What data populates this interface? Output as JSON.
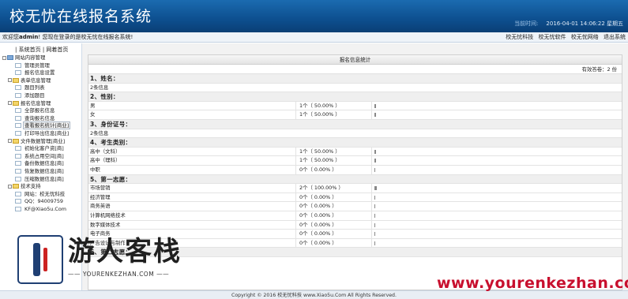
{
  "header": {
    "title": "校无忧在线报名系统",
    "time_label": "当前时间:",
    "time_value": "2016-04-01 14:06:22 星期五"
  },
  "welcome": {
    "prefix": "欢迎您",
    "user": "admin",
    "suffix": "! 您现在登录的是校无忧在线报名系统!",
    "links": [
      "校无忧科技",
      "校无忧软件",
      "校无忧网络",
      "退出系统"
    ]
  },
  "sidebar": {
    "top_links": [
      "系统首页",
      "网着首页"
    ],
    "tree": [
      {
        "label": "网站内容管理",
        "level": 0,
        "type": "root"
      },
      {
        "label": "管理员管理",
        "level": 2,
        "type": "page"
      },
      {
        "label": "报名信息设置",
        "level": 2,
        "type": "page"
      },
      {
        "label": "表单信息管理",
        "level": 1,
        "type": "folder"
      },
      {
        "label": "题目列表",
        "level": 2,
        "type": "page"
      },
      {
        "label": "添加题目",
        "level": 2,
        "type": "page"
      },
      {
        "label": "报名信息管理",
        "level": 1,
        "type": "folder"
      },
      {
        "label": "全部报名信息",
        "level": 2,
        "type": "page"
      },
      {
        "label": "查询报名信息",
        "level": 2,
        "type": "page"
      },
      {
        "label": "查看报名统计[商业]",
        "level": 2,
        "type": "page",
        "active": true
      },
      {
        "label": "打印导出信息[商业]",
        "level": 2,
        "type": "page"
      },
      {
        "label": "文件数据管理[商业]",
        "level": 1,
        "type": "folder"
      },
      {
        "label": "初始化客户资[商]",
        "level": 2,
        "type": "page"
      },
      {
        "label": "系统占用空间[商]",
        "level": 2,
        "type": "page"
      },
      {
        "label": "备份数据信息[商]",
        "level": 2,
        "type": "page"
      },
      {
        "label": "恢复数据信息[商]",
        "level": 2,
        "type": "page"
      },
      {
        "label": "压缩数据信息[商]",
        "level": 2,
        "type": "page"
      },
      {
        "label": "技术支持",
        "level": 1,
        "type": "folder"
      },
      {
        "label": "网站：校无忧科技",
        "level": 2,
        "type": "page"
      },
      {
        "label": "QQ：94009759",
        "level": 2,
        "type": "page"
      },
      {
        "label": "KF@Xiao5u.Com",
        "level": 2,
        "type": "page"
      }
    ]
  },
  "stats": {
    "panel_title": "报名信息统计",
    "valid_count": "有效答卷：2 份",
    "rows": [
      {
        "kind": "sec",
        "text": "1、姓名："
      },
      {
        "kind": "info",
        "text": "2条信息"
      },
      {
        "kind": "sec",
        "text": "2、性别："
      },
      {
        "kind": "opt",
        "label": "男",
        "pct": "1个（ 50.00% ）",
        "fraction": 0.5
      },
      {
        "kind": "opt",
        "label": "女",
        "pct": "1个（ 50.00% ）",
        "fraction": 0.5
      },
      {
        "kind": "sec",
        "text": "3、身份证号："
      },
      {
        "kind": "info",
        "text": "2条信息"
      },
      {
        "kind": "sec",
        "text": "4、考生类别："
      },
      {
        "kind": "opt",
        "label": "高中（文科）",
        "pct": "1个（ 50.00% ）",
        "fraction": 0.5
      },
      {
        "kind": "opt",
        "label": "高中（理科）",
        "pct": "1个（ 50.00% ）",
        "fraction": 0.5
      },
      {
        "kind": "opt",
        "label": "中职",
        "pct": "0个（ 0.00% ）",
        "fraction": 0
      },
      {
        "kind": "sec",
        "text": "5、第一志愿："
      },
      {
        "kind": "opt",
        "label": "市场营销",
        "pct": "2个（ 100.00% ）",
        "fraction": 1.0
      },
      {
        "kind": "opt",
        "label": "经济管理",
        "pct": "0个（ 0.00% ）",
        "fraction": 0
      },
      {
        "kind": "opt",
        "label": "商务英语",
        "pct": "0个（ 0.00% ）",
        "fraction": 0
      },
      {
        "kind": "opt",
        "label": "计算机网络技术",
        "pct": "0个（ 0.00% ）",
        "fraction": 0
      },
      {
        "kind": "opt",
        "label": "数字媒体技术",
        "pct": "0个（ 0.00% ）",
        "fraction": 0
      },
      {
        "kind": "opt",
        "label": "电子商务",
        "pct": "0个（ 0.00% ）",
        "fraction": 0
      },
      {
        "kind": "opt",
        "label": "广告设计与制作",
        "pct": "0个（ 0.00% ）",
        "fraction": 0
      },
      {
        "kind": "sec",
        "text": "6、第二志愿："
      }
    ]
  },
  "footer": {
    "text": "Copyright © 2016 校无忧科技 www.Xiao5u.Com All Rights Reserved."
  },
  "watermark": {
    "name": "游人客栈",
    "sub": "—— YOURENKEZHAN.COM ——",
    "url": "www.yourenkezhan.com"
  },
  "colors": {
    "header_bg": "#0d4f8f",
    "bar_fill": "#888888",
    "watermark_red": "#c8102e"
  }
}
